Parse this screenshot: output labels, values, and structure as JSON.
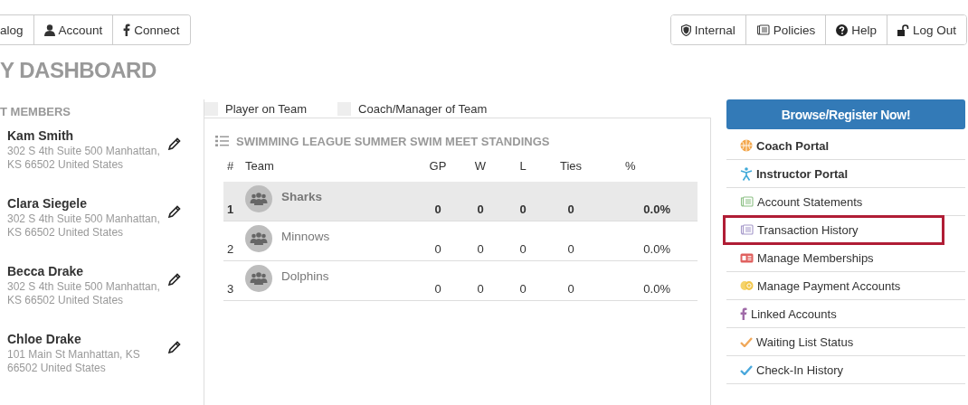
{
  "top_nav_left": [
    {
      "label": "alog",
      "kind": "none"
    },
    {
      "label": "Account",
      "kind": "person"
    },
    {
      "label": "Connect",
      "kind": "facebook"
    }
  ],
  "top_nav_right": [
    {
      "label": "Internal",
      "kind": "shield"
    },
    {
      "label": "Policies",
      "kind": "scroll"
    },
    {
      "label": "Help",
      "kind": "help"
    },
    {
      "label": "Log Out",
      "kind": "lock"
    }
  ],
  "page_title": "Y DASHBOARD",
  "members": {
    "heading": "T MEMBERS",
    "items": [
      {
        "name": "Kam Smith",
        "address": "302 S 4th Suite 500 Manhattan, KS 66502 United States"
      },
      {
        "name": "Clara Siegele",
        "address": "302 S 4th Suite 500 Manhattan, KS 66502 United States"
      },
      {
        "name": "Becca Drake",
        "address": "302 S 4th Suite 500 Manhattan, KS 66502 United States"
      },
      {
        "name": "Chloe Drake",
        "address": "101 Main St Manhattan, KS 66502 United States"
      }
    ]
  },
  "legend": [
    {
      "label": "Player on Team",
      "checked": false
    },
    {
      "label": "Coach/Manager of Team",
      "checked": false
    }
  ],
  "standings": {
    "title": "SWIMMING LEAGUE SUMMER SWIM MEET STANDINGS",
    "columns": [
      "#",
      "Team",
      "GP",
      "W",
      "L",
      "Ties",
      "%"
    ],
    "rows": [
      {
        "rank": "1",
        "team": "Sharks",
        "gp": "0",
        "w": "0",
        "l": "0",
        "ties": "0",
        "pct": "0.0%",
        "selected": true
      },
      {
        "rank": "2",
        "team": "Minnows",
        "gp": "0",
        "w": "0",
        "l": "0",
        "ties": "0",
        "pct": "0.0%",
        "selected": false
      },
      {
        "rank": "3",
        "team": "Dolphins",
        "gp": "0",
        "w": "0",
        "l": "0",
        "ties": "0",
        "pct": "0.0%",
        "selected": false
      }
    ]
  },
  "register_button": "Browse/Register Now!",
  "side_links": [
    {
      "label": "Coach Portal",
      "kind": "ball",
      "bold": true,
      "highlighted": false
    },
    {
      "label": "Instructor Portal",
      "kind": "figure",
      "bold": true,
      "highlighted": false
    },
    {
      "label": "Account Statements",
      "kind": "scroll-green",
      "bold": false,
      "highlighted": false
    },
    {
      "label": "Transaction History",
      "kind": "scroll-purple",
      "bold": false,
      "highlighted": true
    },
    {
      "label": "Manage Memberships",
      "kind": "card",
      "bold": false,
      "highlighted": false
    },
    {
      "label": "Manage Payment Accounts",
      "kind": "coins",
      "bold": false,
      "highlighted": false
    },
    {
      "label": "Linked Accounts",
      "kind": "facebook",
      "bold": false,
      "highlighted": false
    },
    {
      "label": "Waiting List Status",
      "kind": "check-orange",
      "bold": false,
      "highlighted": false
    },
    {
      "label": "Check-In History",
      "kind": "check-blue",
      "bold": false,
      "highlighted": false
    }
  ]
}
